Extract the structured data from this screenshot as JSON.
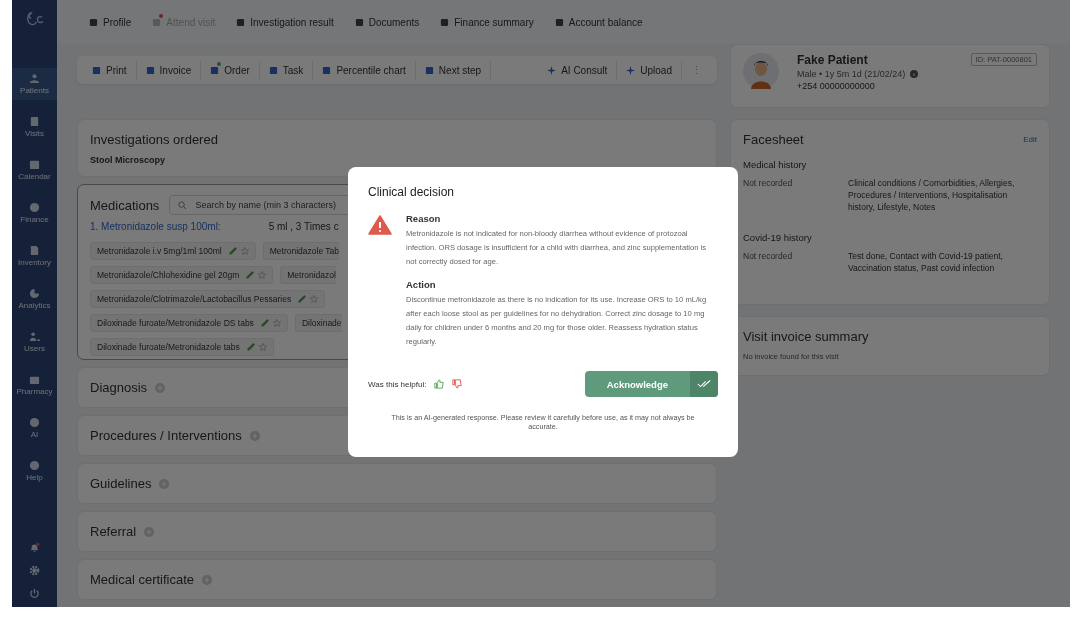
{
  "sidebar": {
    "items": [
      {
        "label": "Patients",
        "selected": true
      },
      {
        "label": "Visits",
        "selected": false
      },
      {
        "label": "Calendar",
        "selected": false
      },
      {
        "label": "Finance",
        "selected": false
      },
      {
        "label": "Inventory",
        "selected": false
      },
      {
        "label": "Analytics",
        "selected": false
      },
      {
        "label": "Users",
        "selected": false
      },
      {
        "label": "Pharmacy",
        "selected": false
      },
      {
        "label": "AI",
        "selected": false
      },
      {
        "label": "Help",
        "selected": false
      }
    ],
    "bell_badge": true
  },
  "tabs": [
    {
      "label": "Profile",
      "disabled": false,
      "badge": false
    },
    {
      "label": "Attend visit",
      "disabled": true,
      "badge": true
    },
    {
      "label": "Investigation result",
      "disabled": false,
      "badge": false
    },
    {
      "label": "Documents",
      "disabled": false,
      "badge": false
    },
    {
      "label": "Finance summary",
      "disabled": false,
      "badge": false
    },
    {
      "label": "Account balance",
      "disabled": false,
      "badge": false
    }
  ],
  "toolbar": {
    "left": [
      {
        "label": "Print",
        "badge": false
      },
      {
        "label": "Invoice",
        "badge": false
      },
      {
        "label": "Order",
        "badge": true
      },
      {
        "label": "Task",
        "badge": false
      },
      {
        "label": "Percentile chart",
        "badge": false
      },
      {
        "label": "Next step",
        "badge": false
      }
    ],
    "right": [
      {
        "label": "AI Consult",
        "badge": false
      },
      {
        "label": "Upload",
        "badge": false
      }
    ],
    "more": "⋮"
  },
  "investigations": {
    "title": "Investigations ordered",
    "items": [
      "Stool Microscopy"
    ]
  },
  "medications": {
    "title": "Medications",
    "search": {
      "placeholder": "Search by name (min 3 characters)"
    },
    "prescription": "1. Metronidazole susp 100ml:",
    "dose": "5 ml , 3 Times c",
    "chip_rows": [
      {
        "chips": [
          {
            "label": "Metronidazole i.v 5mg/1ml 100ml",
            "cut": false
          },
          {
            "label": "Metronidazole Tab",
            "cut": true
          }
        ]
      },
      {
        "chips": [
          {
            "label": "Metronidazole/Chlohexidine gel 20gm",
            "cut": false
          },
          {
            "label": "Metronidazol",
            "cut": true
          }
        ]
      },
      {
        "chips": [
          {
            "label": "Metronidazole/Clotrimazole/Lactobacillus Pessaries",
            "cut": false
          }
        ]
      },
      {
        "chips": [
          {
            "label": "Diloxinade furoate/Metronidazole DS tabs",
            "cut": false
          },
          {
            "label": "Diloxinade",
            "cut": true
          }
        ]
      },
      {
        "chips": [
          {
            "label": "Diloxinade furoate/Metronidazole tabs",
            "cut": false
          }
        ]
      }
    ]
  },
  "sections": [
    "Diagnosis",
    "Procedures / Interventions",
    "Guidelines",
    "Referral",
    "Medical certificate"
  ],
  "patient": {
    "name": "Fake Patient",
    "id": "ID: PAT-0000801",
    "details": "Male • 1y 5m 1d (21/02/24)",
    "phone": "+254 00000000000"
  },
  "facesheet": {
    "title": "Facesheet",
    "edit": "Edit",
    "groups": [
      {
        "title": "Medical history",
        "status": "Not recorded",
        "items": "Clinical conditions / Comorbidities, Allergies, Procedures / Interventions, Hospitalisation history, Lifestyle, Notes"
      },
      {
        "title": "Covid-19 history",
        "status": "Not recorded",
        "items": "Test done, Contact with Covid-19 patient, Vaccination status, Past covid infection"
      }
    ]
  },
  "invoice": {
    "title": "Visit invoice summary",
    "text": "No invoice found for this visit"
  },
  "modal": {
    "title": "Clinical decision",
    "blocks": [
      {
        "heading": "Reason",
        "text": "Metronidazole is not indicated for non-bloody diarrhea without evidence of protozoal infection. ORS dosage is insufficient for a child with diarrhea, and zinc supplementation is not correctly dosed for age."
      },
      {
        "heading": "Action",
        "text": "Discontinue metronidazole as there is no indication for its use. Increase ORS to 10 mL/kg after each loose stool as per guidelines for no dehydration. Correct zinc dosage to 10 mg daily for children under 6 months and 20 mg for those older. Reassess hydration status regularly."
      }
    ],
    "helpful": "Was this helpful:",
    "button": "Acknowledge",
    "disclaimer": "This is an AI-generated response. Please review it carefully before use, as it may not always be accurate."
  }
}
